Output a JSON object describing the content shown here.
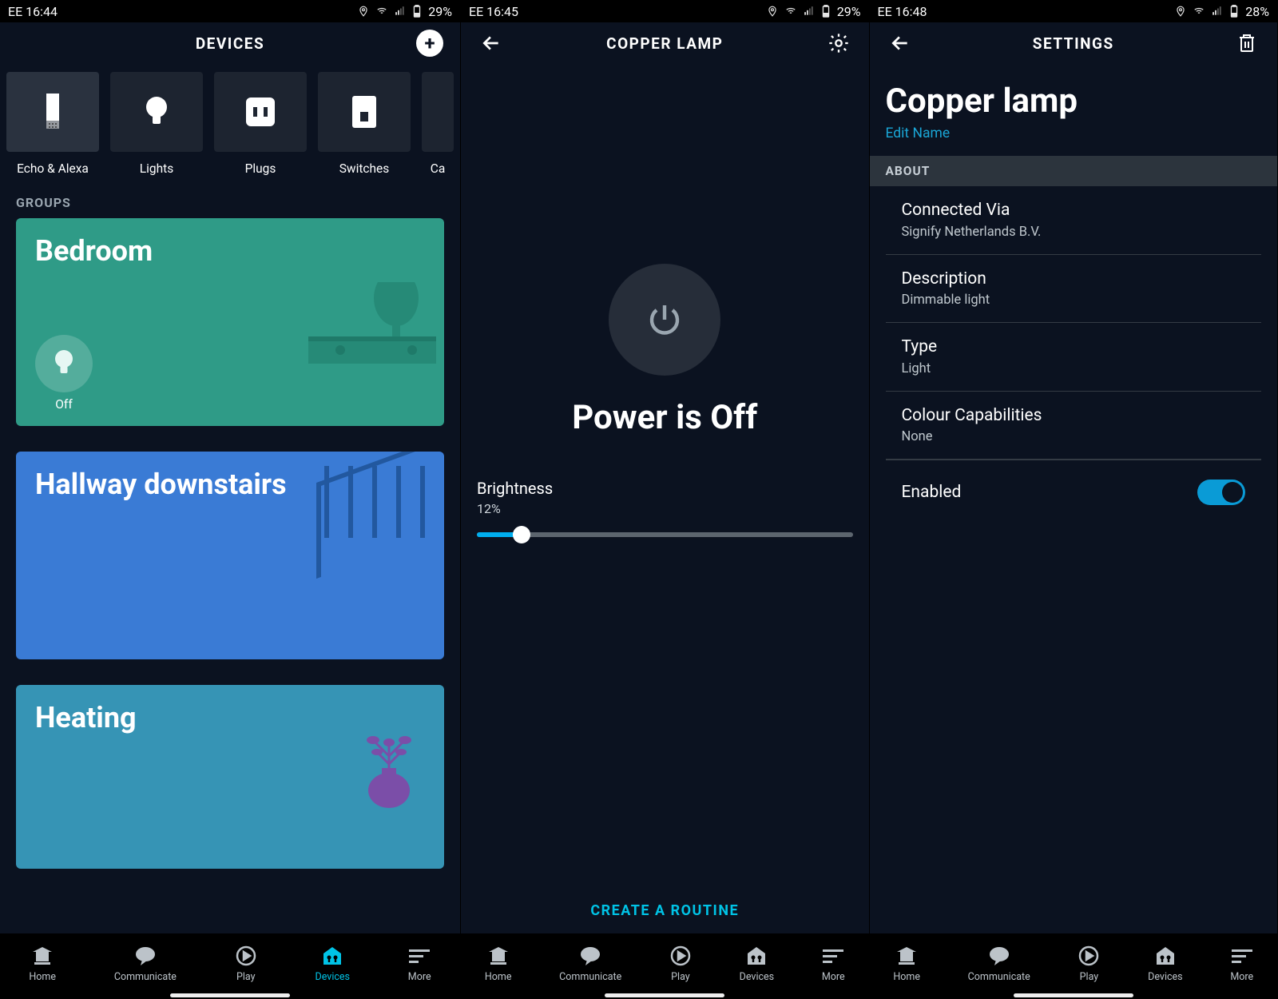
{
  "screen1": {
    "status": {
      "carrier": "EE",
      "time": "16:44",
      "battery": "29%"
    },
    "header": {
      "title": "DEVICES"
    },
    "categories": [
      {
        "label": "Echo & Alexa"
      },
      {
        "label": "Lights"
      },
      {
        "label": "Plugs"
      },
      {
        "label": "Switches"
      },
      {
        "label": "Ca"
      }
    ],
    "groups_label": "GROUPS",
    "groups": [
      {
        "title": "Bedroom",
        "state": "Off"
      },
      {
        "title": "Hallway downstairs"
      },
      {
        "title": "Heating"
      }
    ]
  },
  "screen2": {
    "status": {
      "carrier": "EE",
      "time": "16:45",
      "battery": "29%"
    },
    "header": {
      "title": "COPPER LAMP"
    },
    "power_label": "Power is Off",
    "brightness_label": "Brightness",
    "brightness_value": "12%",
    "brightness_percent": 12,
    "create_routine": "CREATE A ROUTINE"
  },
  "screen3": {
    "status": {
      "carrier": "EE",
      "time": "16:48",
      "battery": "28%"
    },
    "header": {
      "title": "SETTINGS"
    },
    "device_name": "Copper lamp",
    "edit_name": "Edit Name",
    "about_label": "ABOUT",
    "rows": [
      {
        "key": "Connected Via",
        "val": "Signify Netherlands B.V."
      },
      {
        "key": "Description",
        "val": "Dimmable light"
      },
      {
        "key": "Type",
        "val": "Light"
      },
      {
        "key": "Colour Capabilities",
        "val": "None"
      }
    ],
    "enabled_label": "Enabled",
    "enabled_value": true
  },
  "nav": {
    "items": [
      {
        "label": "Home"
      },
      {
        "label": "Communicate"
      },
      {
        "label": "Play"
      },
      {
        "label": "Devices"
      },
      {
        "label": "More"
      }
    ]
  }
}
